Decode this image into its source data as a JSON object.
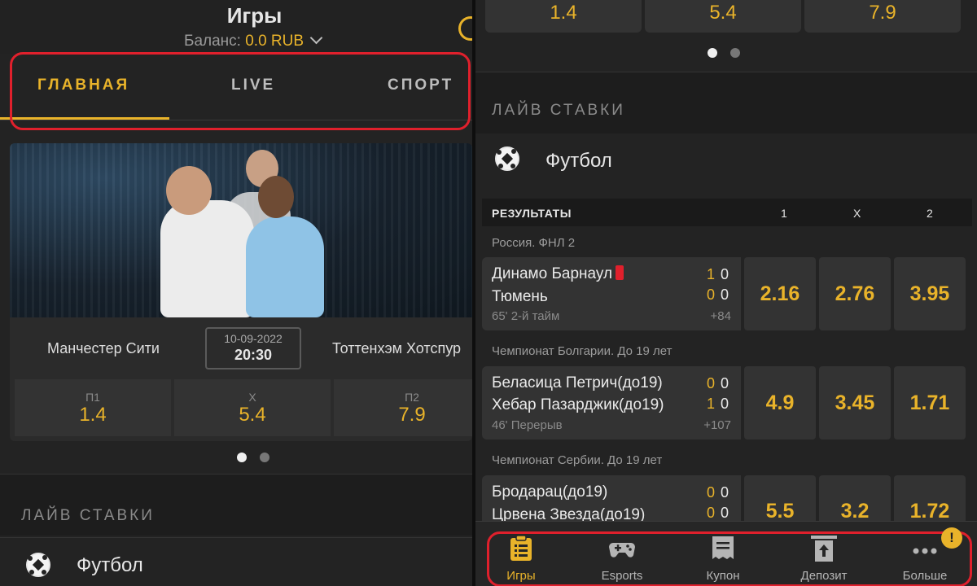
{
  "left": {
    "title": "Игры",
    "balance_label": "Баланс: ",
    "balance_amount": "0.0 RUB",
    "tabs": [
      {
        "label": "ГЛАВНАЯ",
        "active": true
      },
      {
        "label": "LIVE",
        "active": false
      },
      {
        "label": "СПОРТ",
        "active": false
      }
    ],
    "featured": {
      "home": "Манчестер Сити",
      "away": "Тоттенхэм Хотспур",
      "date": "10-09-2022",
      "time": "20:30",
      "odds": [
        {
          "label": "П1",
          "value": "1.4"
        },
        {
          "label": "Х",
          "value": "5.4"
        },
        {
          "label": "П2",
          "value": "7.9"
        }
      ]
    },
    "section_title": "ЛАЙВ СТАВКИ",
    "sport": "Футбол"
  },
  "right": {
    "top_odds": [
      "1.4",
      "5.4",
      "7.9"
    ],
    "section_title": "ЛАЙВ СТАВКИ",
    "sport": "Футбол",
    "results_header": {
      "label": "РЕЗУЛЬТАТЫ",
      "c1": "1",
      "cx": "X",
      "c2": "2"
    },
    "matches": [
      {
        "league": "Россия. ФНЛ 2",
        "team1": "Динамо Барнаул",
        "team2": "Тюмень",
        "score1a": "1",
        "score1b": "0",
        "score2a": "0",
        "score2b": "0",
        "status": "65' 2-й тайм",
        "more": "+84",
        "odds": [
          "2.16",
          "2.76",
          "3.95"
        ]
      },
      {
        "league": "Чемпионат Болгарии. До 19 лет",
        "team1": "Беласица Петрич(до19)",
        "team2": "Хебар Пазарджик(до19)",
        "score1a": "0",
        "score1b": "0",
        "score2a": "1",
        "score2b": "0",
        "status": "46' Перерыв",
        "more": "+107",
        "odds": [
          "4.9",
          "3.45",
          "1.71"
        ]
      },
      {
        "league": "Чемпионат Сербии. До 19 лет",
        "team1": "Бродарац(до19)",
        "team2": "Црвена Звезда(до19)",
        "score1a": "0",
        "score1b": "0",
        "score2a": "0",
        "score2b": "0",
        "status": "",
        "more": "",
        "odds": [
          "5.5",
          "3.2",
          "1.72"
        ]
      }
    ],
    "nav": [
      {
        "label": "Игры",
        "icon": "clipboard-icon",
        "active": true
      },
      {
        "label": "Esports",
        "icon": "gamepad-icon",
        "active": false
      },
      {
        "label": "Купон",
        "icon": "coupon-icon",
        "active": false
      },
      {
        "label": "Депозит",
        "icon": "deposit-icon",
        "active": false
      },
      {
        "label": "Больше",
        "icon": "more-icon",
        "active": false
      }
    ],
    "badge": "!"
  },
  "colors": {
    "accent": "#e9b32a",
    "highlight": "#e0202c",
    "background": "#232323"
  }
}
